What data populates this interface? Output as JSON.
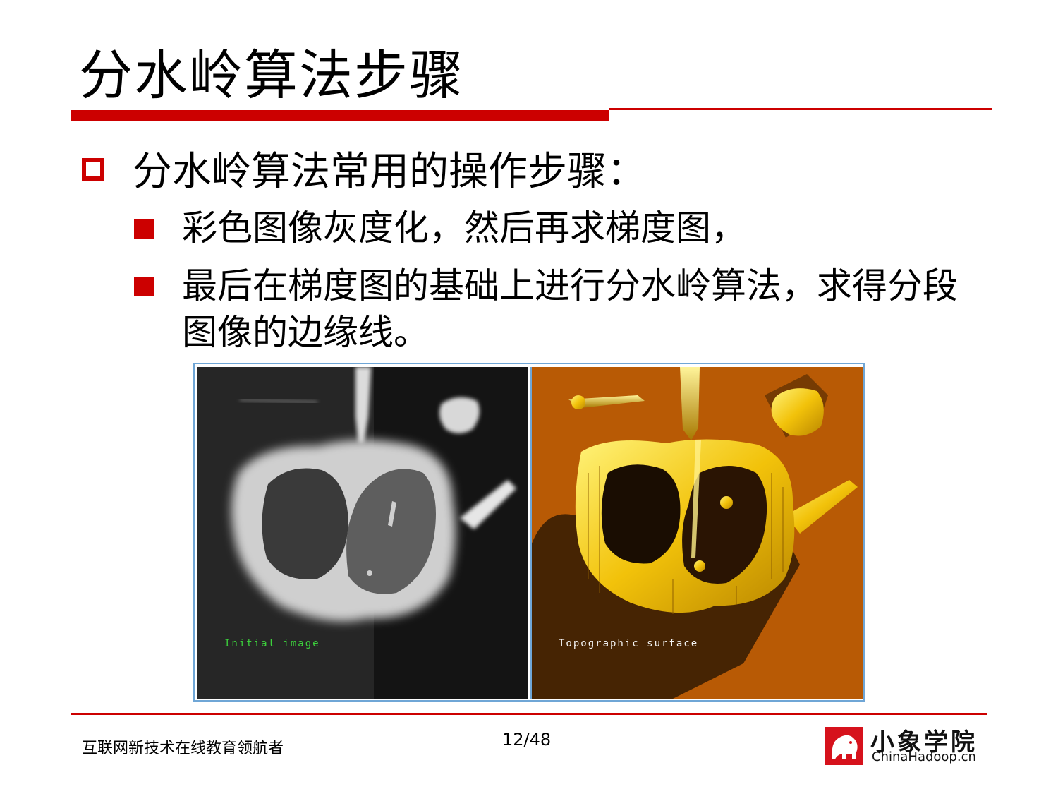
{
  "slide": {
    "title": "分水岭算法步骤",
    "accent_color": "#cc0000"
  },
  "bullets": {
    "main": "分水岭算法常用的操作步骤：",
    "sub": [
      "彩色图像灰度化，然后再求梯度图，",
      "最后在梯度图的基础上进行分水岭算法，求得分段图像的边缘线。"
    ]
  },
  "figure": {
    "left_caption": "Initial image",
    "right_caption": "Topographic surface"
  },
  "footer": {
    "tagline": "互联网新技术在线教育领航者",
    "page": "12/48",
    "logo_name": "小象学院",
    "logo_domain": "ChinaHadoop.cn"
  }
}
